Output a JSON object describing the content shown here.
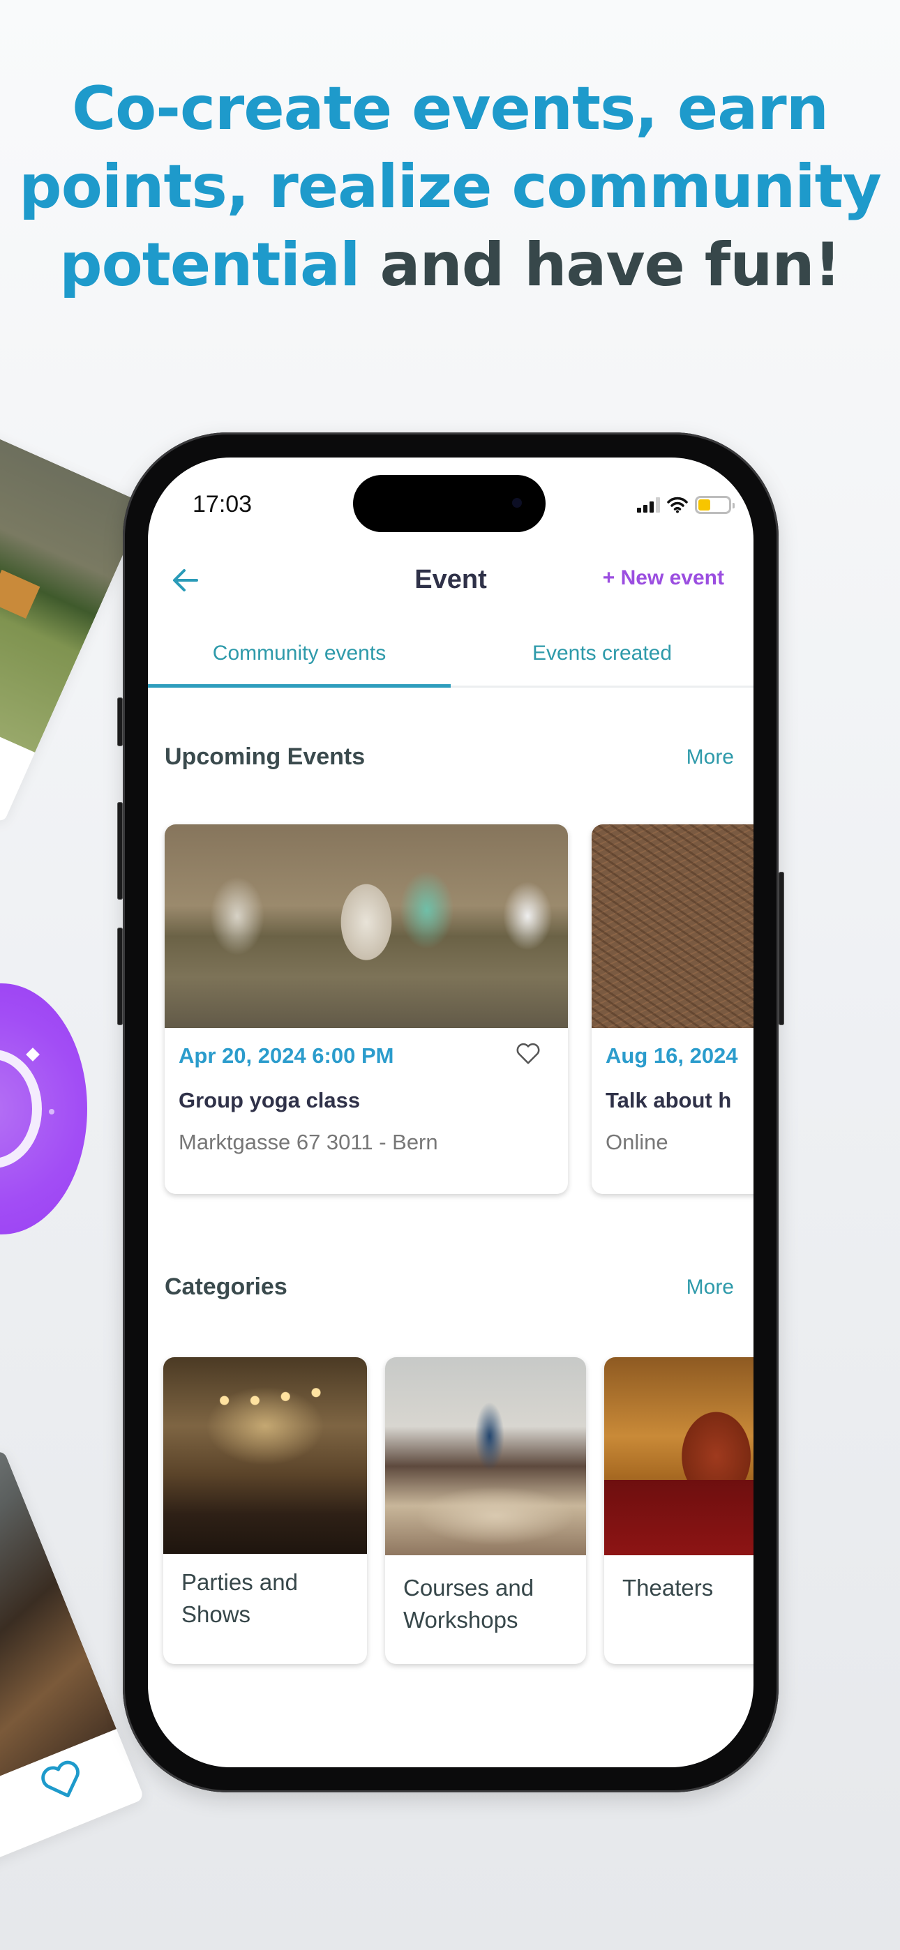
{
  "headline": {
    "highlight": "Co-create events, earn points, realize community potential",
    "rest": "and have fun!"
  },
  "colors": {
    "brand_blue": "#1e9acb",
    "headline_dark": "#37474a",
    "accent_purple": "#9b4ee0",
    "tab_teal": "#2e9aaa",
    "battery_yellow": "#f7c500"
  },
  "status_bar": {
    "time": "17:03",
    "signal_bars_active": 3,
    "signal_bars_total": 4,
    "wifi": "wifi-icon",
    "battery_level": 0.4
  },
  "header": {
    "back_icon": "arrow-left-icon",
    "title": "Event",
    "new_event_label": "+ New event"
  },
  "tabs": [
    {
      "label": "Community events",
      "active": true
    },
    {
      "label": "Events created",
      "active": false
    }
  ],
  "upcoming": {
    "title": "Upcoming Events",
    "more_label": "More",
    "events": [
      {
        "date": "Apr 20, 2024 6:00 PM",
        "name": "Group yoga class",
        "place": "Marktgasse 67 3011 - Bern",
        "image": "yoga-class-photo",
        "favorite_icon": "heart-outline-icon"
      },
      {
        "date": "Aug 16, 2024",
        "name": "Talk about h",
        "place": "Online",
        "image": "pine-needles-photo"
      }
    ]
  },
  "categories": {
    "title": "Categories",
    "more_label": "More",
    "items": [
      {
        "label": "Parties and Shows",
        "image": "concert-photo"
      },
      {
        "label": "Courses and Workshops",
        "image": "workshop-photo"
      },
      {
        "label": "Theaters",
        "image": "theater-photo"
      }
    ]
  },
  "decorations": {
    "badge_icon": "purple-badge-icon",
    "heart_icon": "heart-outline-icon"
  }
}
